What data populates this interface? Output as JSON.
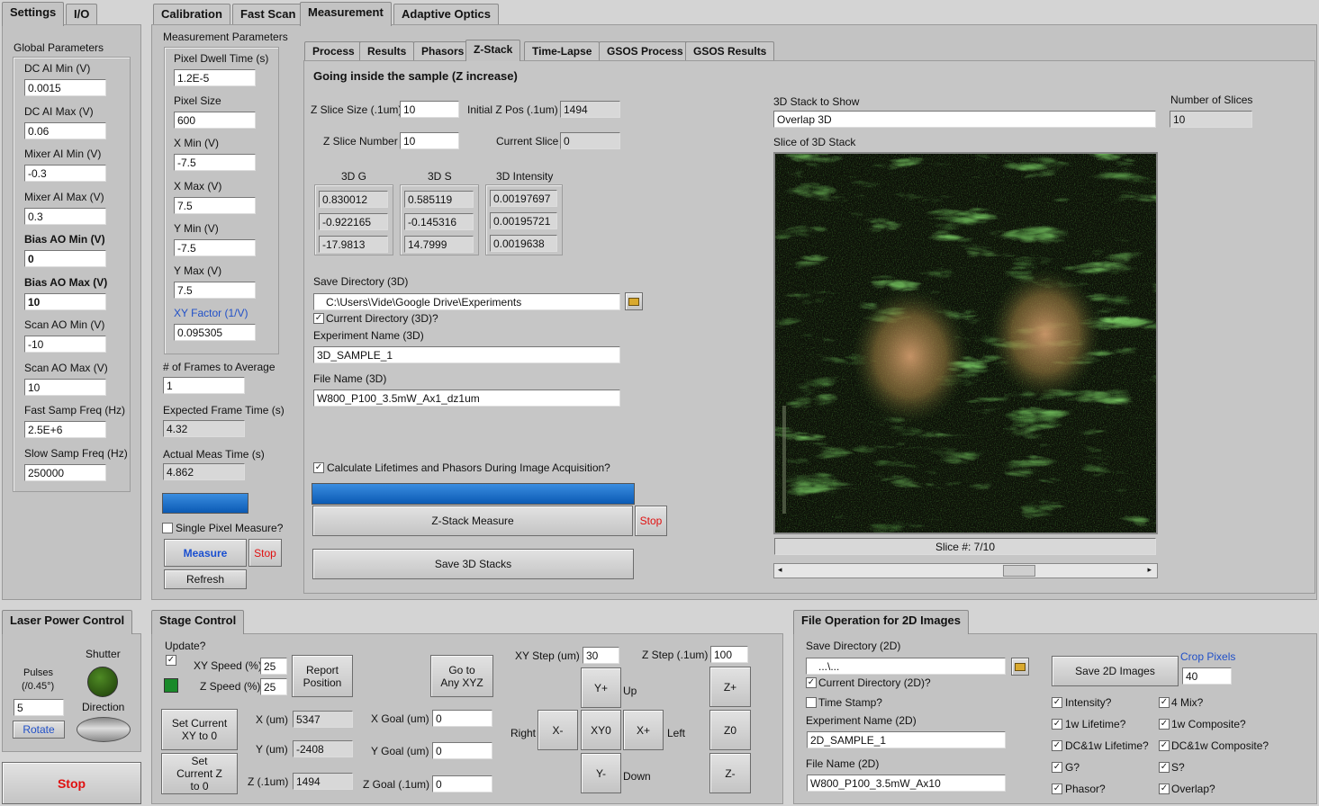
{
  "top_tabs_left": [
    "Settings",
    "I/O"
  ],
  "top_tabs_main": [
    "Calibration",
    "Fast Scan",
    "Measurement",
    "Adaptive Optics"
  ],
  "global": {
    "title": "Global Parameters",
    "fields": [
      {
        "label": "DC AI Min (V)",
        "value": "0.0015",
        "bold": false
      },
      {
        "label": "DC AI Max (V)",
        "value": "0.06",
        "bold": false
      },
      {
        "label": "Mixer AI Min (V)",
        "value": "-0.3",
        "bold": false
      },
      {
        "label": "Mixer AI Max (V)",
        "value": "0.3",
        "bold": false
      },
      {
        "label": "Bias AO Min (V)",
        "value": "0",
        "bold": true
      },
      {
        "label": "Bias AO Max (V)",
        "value": "10",
        "bold": true
      },
      {
        "label": "Scan AO Min (V)",
        "value": "-10",
        "bold": false
      },
      {
        "label": "Scan AO Max (V)",
        "value": "10",
        "bold": false
      },
      {
        "label": "Fast Samp Freq (Hz)",
        "value": "2.5E+6",
        "bold": false
      },
      {
        "label": "Slow Samp Freq (Hz)",
        "value": "250000",
        "bold": false
      }
    ]
  },
  "meas": {
    "title": "Measurement Parameters",
    "fields": [
      {
        "label": "Pixel Dwell Time (s)",
        "value": "1.2E-5",
        "blue": false
      },
      {
        "label": "Pixel Size",
        "value": "600",
        "blue": false
      },
      {
        "label": "X Min (V)",
        "value": "-7.5",
        "blue": false
      },
      {
        "label": "X Max (V)",
        "value": "7.5",
        "blue": false
      },
      {
        "label": "Y Min (V)",
        "value": "-7.5",
        "blue": false
      },
      {
        "label": "Y Max (V)",
        "value": "7.5",
        "blue": false
      },
      {
        "label": "XY Factor (1/V)",
        "value": "0.095305",
        "blue": true
      }
    ],
    "frames_label": "# of Frames to Average",
    "frames_value": "1",
    "expected_label": "Expected Frame Time (s)",
    "expected_value": "4.32",
    "actual_label": "Actual Meas Time (s)",
    "actual_value": "4.862",
    "single_pixel": "Single Pixel Measure?",
    "measure": "Measure",
    "stop": "Stop",
    "refresh": "Refresh"
  },
  "sub_tabs": [
    "Process",
    "Results",
    "Phasors",
    "Z-Stack",
    "Time-Lapse",
    "GSOS Process",
    "GSOS Results"
  ],
  "zstack": {
    "heading": "Going inside the sample (Z increase)",
    "slice_size_label": "Z Slice Size (.1um)",
    "slice_size": "10",
    "init_z_label": "Initial Z Pos (.1um)",
    "init_z": "1494",
    "slice_num_label": "Z Slice Number",
    "slice_num": "10",
    "cur_slice_label": "Current Slice",
    "cur_slice": "0",
    "g_label": "3D G",
    "g_values": [
      "0.830012",
      "-0.922165",
      "-17.9813"
    ],
    "s_label": "3D S",
    "s_values": [
      "0.585119",
      "-0.145316",
      "14.7999"
    ],
    "i_label": "3D Intensity",
    "i_values": [
      "0.00197697",
      "0.00195721",
      "0.0019638"
    ],
    "save_dir_label": "Save Directory (3D)",
    "save_dir": "C:\\Users\\Vide\\Google Drive\\Experiments",
    "cur_dir": "Current Directory (3D)?",
    "exp_name_label": "Experiment Name (3D)",
    "exp_name": "3D_SAMPLE_1",
    "file_name_label": "File Name (3D)",
    "file_name": "W800_P100_3.5mW_Ax1_dz1um",
    "calc": "Calculate Lifetimes and Phasors During Image Acquisition?",
    "zstack_btn": "Z-Stack Measure",
    "stop": "Stop",
    "save_btn": "Save 3D Stacks",
    "show_label": "3D Stack to Show",
    "show_value": "Overlap 3D",
    "nslices_label": "Number of Slices",
    "nslices": "10",
    "slice_label": "Slice of 3D Stack",
    "slice_readout": "Slice #: 7/10",
    "progress": 1.0
  },
  "laser": {
    "title": "Laser Power Control",
    "shutter": "Shutter",
    "pulses": "Pulses",
    "pulses_unit": "(/0.45°)",
    "pulses_value": "5",
    "direction": "Direction",
    "rotate": "Rotate",
    "stop": "Stop"
  },
  "stage": {
    "title": "Stage Control",
    "update": "Update?",
    "xy_speed_label": "XY Speed (%)",
    "xy_speed": "25",
    "z_speed_label": "Z Speed (%)",
    "z_speed": "25",
    "report": "Report Position",
    "goto": "Go to Any XYZ",
    "set_xy": "Set Current XY to 0",
    "set_z": "Set Current Z to 0",
    "x_label": "X (um)",
    "x": "5347",
    "y_label": "Y (um)",
    "y": "-2408",
    "z_label": "Z (.1um)",
    "z": "1494",
    "xg_label": "X Goal (um)",
    "xg": "0",
    "yg_label": "Y Goal (um)",
    "yg": "0",
    "zg_label": "Z Goal (.1um)",
    "zg": "0",
    "xy_step_label": "XY Step (um)",
    "xy_step": "30",
    "z_step_label": "Z Step (.1um)",
    "z_step": "100",
    "yplus": "Y+",
    "yminus": "Y-",
    "xminus": "X-",
    "xplus": "X+",
    "xy0": "XY0",
    "zplus": "Z+",
    "z0": "Z0",
    "zminus": "Z-",
    "up": "Up",
    "down": "Down",
    "left": "Left",
    "right": "Right"
  },
  "file2d": {
    "title": "File Operation for 2D Images",
    "save_dir_label": "Save Directory (2D)",
    "save_dir": "...\\...",
    "cur_dir": "Current Directory (2D)?",
    "time_stamp": "Time Stamp?",
    "exp_label": "Experiment Name (2D)",
    "exp": "2D_SAMPLE_1",
    "file_label": "File Name (2D)",
    "file": "W800_P100_3.5mW_Ax10",
    "save_btn": "Save 2D Images",
    "crop_label": "Crop Pixels",
    "crop": "40",
    "checks_left": [
      "Intensity?",
      "1w Lifetime?",
      "DC&1w Lifetime?",
      "G?",
      "Phasor?"
    ],
    "checks_right": [
      "4 Mix?",
      "1w Composite?",
      "DC&1w Composite?",
      "S?",
      "Overlap?"
    ]
  },
  "colors": {
    "progress": "#1565c0",
    "stop_text": "#e01010",
    "blue_label": "#2050c8",
    "led_on": "#1a8a2a",
    "shutter_led": "#2c5a10"
  }
}
